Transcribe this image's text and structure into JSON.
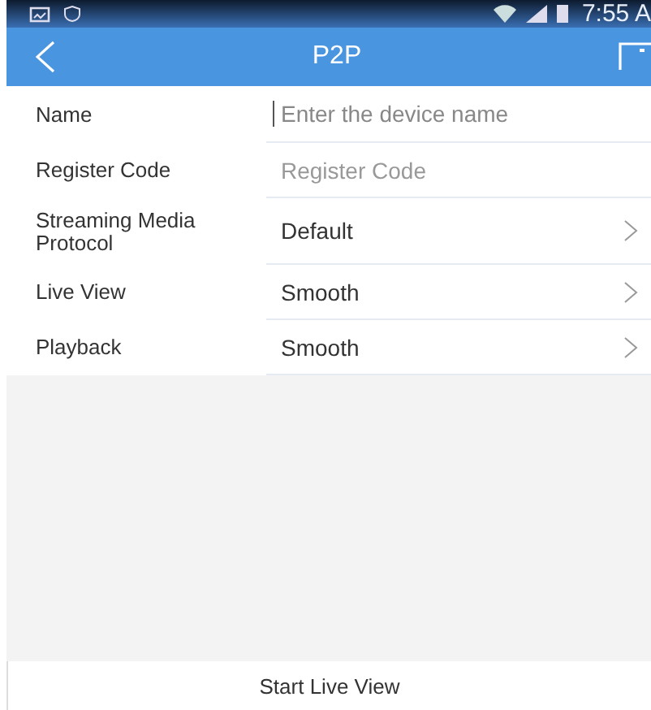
{
  "status_bar": {
    "time": "7:55 A"
  },
  "nav": {
    "title": "P2P"
  },
  "fields": [
    {
      "kind": "input",
      "label": "Name",
      "placeholder": "Enter the device name",
      "focused": true
    },
    {
      "kind": "input",
      "label": "Register Code",
      "placeholder": "Register Code",
      "focused": false
    },
    {
      "kind": "select",
      "label": "Streaming Media Protocol",
      "value": "Default"
    },
    {
      "kind": "select",
      "label": "Live View",
      "value": "Smooth"
    },
    {
      "kind": "select",
      "label": "Playback",
      "value": "Smooth"
    }
  ],
  "action": {
    "label": "Start Live View"
  }
}
